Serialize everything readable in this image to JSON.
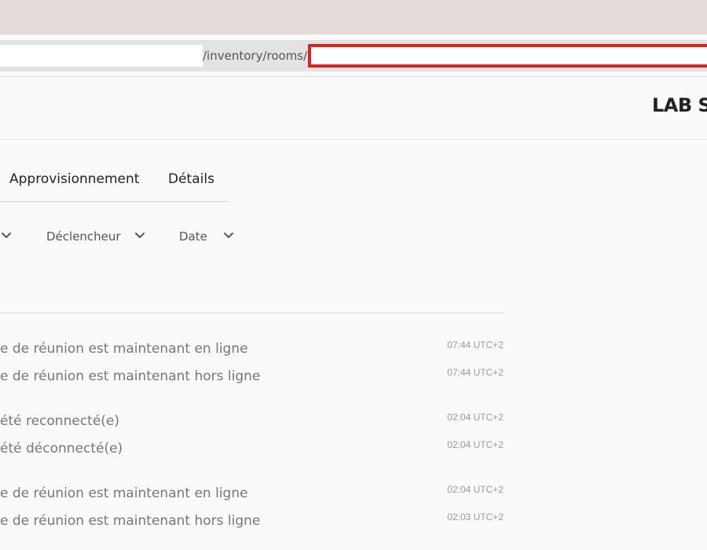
{
  "browser": {
    "url_path": "/inventory/rooms/"
  },
  "page": {
    "title": "LAB S"
  },
  "tabs": [
    {
      "label": "Approvisionnement"
    },
    {
      "label": "Détails"
    }
  ],
  "filters": [
    {
      "label": "",
      "icon": "chevron-down-icon"
    },
    {
      "label": "Déclencheur",
      "icon": "chevron-down-icon"
    },
    {
      "label": "Date",
      "icon": "chevron-down-icon"
    }
  ],
  "events": [
    {
      "text": "e de réunion est maintenant en ligne",
      "time": "07:44 UTC+2"
    },
    {
      "text": "e de réunion est maintenant hors ligne",
      "time": "07:44 UTC+2"
    },
    {
      "text": "été reconnecté(e)",
      "time": "02:04 UTC+2"
    },
    {
      "text": "été déconnecté(e)",
      "time": "02:04 UTC+2"
    },
    {
      "text": "e de réunion est maintenant en ligne",
      "time": "02:04 UTC+2"
    },
    {
      "text": "e de réunion est maintenant hors ligne",
      "time": "02:03 UTC+2"
    }
  ],
  "colors": {
    "highlight_border": "#e02020",
    "browser_chrome": "#e4dbd8",
    "page_background": "#fafafa"
  }
}
